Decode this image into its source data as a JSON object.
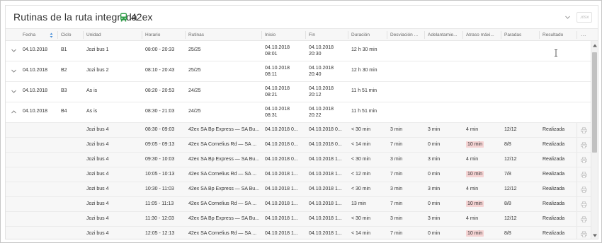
{
  "header": {
    "title": "Rutinas de la ruta integrada",
    "route": "42ex",
    "export_label": ".xlsx",
    "icons": {
      "bus": "bus-icon",
      "dropdown": "chevron-down-icon"
    },
    "accent_color": "#2e9e48"
  },
  "columns": [
    "Fecha",
    "Ciclo",
    "Unidad",
    "Horario",
    "Rutinas",
    "Inicio",
    "Fin",
    "Duración",
    "Desviación ...",
    "Adelantamie...",
    "Atraso máxi...",
    "Paradas",
    "Resultado",
    "..."
  ],
  "rows": [
    {
      "fecha": "04.10.2018",
      "ciclo": "B1",
      "unidad": "Jozi bus 1",
      "horario": "08:00 - 20:33",
      "rutinas": "25/25",
      "inicio_d": "04.10.2018",
      "inicio_t": "08:01",
      "fin_d": "04.10.2018",
      "fin_t": "20:30",
      "duracion": "12 h 30 min",
      "expanded": false
    },
    {
      "fecha": "04.10.2018",
      "ciclo": "B2",
      "unidad": "Jozi bus 2",
      "horario": "08:10 - 20:43",
      "rutinas": "25/25",
      "inicio_d": "04.10.2018",
      "inicio_t": "08:11",
      "fin_d": "04.10.2018",
      "fin_t": "20:40",
      "duracion": "12 h 30 min",
      "expanded": false
    },
    {
      "fecha": "04.10.2018",
      "ciclo": "B3",
      "unidad": "As is",
      "horario": "08:20 - 20:53",
      "rutinas": "24/25",
      "inicio_d": "04.10.2018",
      "inicio_t": "08:21",
      "fin_d": "04.10.2018",
      "fin_t": "20:12",
      "duracion": "11 h 51 min",
      "expanded": false
    },
    {
      "fecha": "04.10.2018",
      "ciclo": "B4",
      "unidad": "As is",
      "horario": "08:30 - 21:03",
      "rutinas": "24/25",
      "inicio_d": "04.10.2018",
      "inicio_t": "08:31",
      "fin_d": "04.10.2018",
      "fin_t": "20:22",
      "duracion": "11 h 51 min",
      "expanded": true
    }
  ],
  "subrows": [
    {
      "unidad": "Jozi bus 4",
      "horario": "08:30 - 09:03",
      "rutina": "42ex SA Bp Express — SA Bu...",
      "inicio": "04.10.2018 0...",
      "fin": "04.10.2018 0...",
      "duracion": "< 30 min",
      "desviacion": "3 min",
      "adelantamiento": "3 min",
      "atraso": "4 min",
      "atraso_alert": false,
      "paradas": "12/12",
      "resultado": "Realizada"
    },
    {
      "unidad": "Jozi bus 4",
      "horario": "09:05 - 09:13",
      "rutina": "42ex SA Cornelius Rd — SA ...",
      "inicio": "04.10.2018 0...",
      "fin": "04.10.2018 0...",
      "duracion": "< 14 min",
      "desviacion": "7 min",
      "adelantamiento": "0 min",
      "atraso": "10 min",
      "atraso_alert": true,
      "paradas": "8/8",
      "resultado": "Realizada"
    },
    {
      "unidad": "Jozi bus 4",
      "horario": "09:30 - 10:03",
      "rutina": "42ex SA Bp Express — SA Bu...",
      "inicio": "04.10.2018 0...",
      "fin": "04.10.2018 1...",
      "duracion": "< 30 min",
      "desviacion": "3 min",
      "adelantamiento": "3 min",
      "atraso": "4 min",
      "atraso_alert": false,
      "paradas": "12/12",
      "resultado": "Realizada"
    },
    {
      "unidad": "Jozi bus 4",
      "horario": "10:05 - 10:13",
      "rutina": "42ex SA Cornelius Rd — SA ...",
      "inicio": "04.10.2018 1...",
      "fin": "04.10.2018 1...",
      "duracion": "< 12 min",
      "desviacion": "7 min",
      "adelantamiento": "0 min",
      "atraso": "10 min",
      "atraso_alert": true,
      "paradas": "7/8",
      "resultado": "Realizada"
    },
    {
      "unidad": "Jozi bus 4",
      "horario": "10:30 - 11:03",
      "rutina": "42ex SA Bp Express — SA Bu...",
      "inicio": "04.10.2018 1...",
      "fin": "04.10.2018 1...",
      "duracion": "< 30 min",
      "desviacion": "3 min",
      "adelantamiento": "3 min",
      "atraso": "4 min",
      "atraso_alert": false,
      "paradas": "12/12",
      "resultado": "Realizada"
    },
    {
      "unidad": "Jozi bus 4",
      "horario": "11:05 - 11:13",
      "rutina": "42ex SA Cornelius Rd — SA ...",
      "inicio": "04.10.2018 1...",
      "fin": "04.10.2018 1...",
      "duracion": "13 min",
      "desviacion": "7 min",
      "adelantamiento": "0 min",
      "atraso": "10 min",
      "atraso_alert": true,
      "paradas": "8/8",
      "resultado": "Realizada"
    },
    {
      "unidad": "Jozi bus 4",
      "horario": "11:30 - 12:03",
      "rutina": "42ex SA Bp Express — SA Bu...",
      "inicio": "04.10.2018 1...",
      "fin": "04.10.2018 1...",
      "duracion": "< 30 min",
      "desviacion": "3 min",
      "adelantamiento": "3 min",
      "atraso": "4 min",
      "atraso_alert": false,
      "paradas": "12/12",
      "resultado": "Realizada"
    },
    {
      "unidad": "Jozi bus 4",
      "horario": "12:05 - 12:13",
      "rutina": "42ex SA Cornelius Rd — SA ...",
      "inicio": "04.10.2018 1...",
      "fin": "04.10.2018 1...",
      "duracion": "< 14 min",
      "desviacion": "7 min",
      "adelantamiento": "0 min",
      "atraso": "10 min",
      "atraso_alert": true,
      "paradas": "8/8",
      "resultado": "Realizada"
    }
  ],
  "colors": {
    "alert_bg": "#f6d4d4",
    "sort_icon": "#4a90d9"
  }
}
